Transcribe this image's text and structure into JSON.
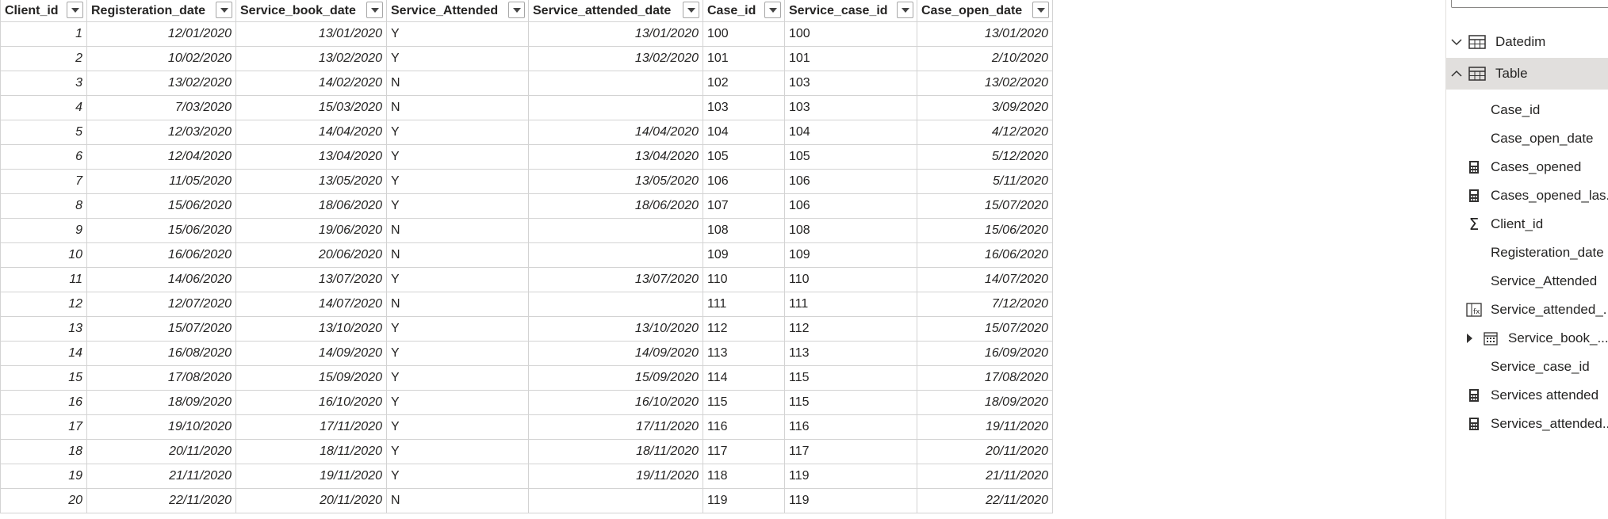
{
  "table": {
    "columns": [
      {
        "key": "Client_id",
        "label": "Client_id",
        "align": "num"
      },
      {
        "key": "Registeration_date",
        "label": "Registeration_date",
        "align": "num"
      },
      {
        "key": "Service_book_date",
        "label": "Service_book_date",
        "align": "num"
      },
      {
        "key": "Service_Attended",
        "label": "Service_Attended",
        "align": "txt"
      },
      {
        "key": "Service_attended_date",
        "label": "Service_attended_date",
        "align": "num"
      },
      {
        "key": "Case_id",
        "label": "Case_id",
        "align": "txt"
      },
      {
        "key": "Service_case_id",
        "label": "Service_case_id",
        "align": "txt"
      },
      {
        "key": "Case_open_date",
        "label": "Case_open_date",
        "align": "num"
      }
    ],
    "rows": [
      [
        "1",
        "12/01/2020",
        "13/01/2020",
        "Y",
        "13/01/2020",
        "100",
        "100",
        "13/01/2020"
      ],
      [
        "2",
        "10/02/2020",
        "13/02/2020",
        "Y",
        "13/02/2020",
        "101",
        "101",
        "2/10/2020"
      ],
      [
        "3",
        "13/02/2020",
        "14/02/2020",
        "N",
        "",
        "102",
        "103",
        "13/02/2020"
      ],
      [
        "4",
        "7/03/2020",
        "15/03/2020",
        "N",
        "",
        "103",
        "103",
        "3/09/2020"
      ],
      [
        "5",
        "12/03/2020",
        "14/04/2020",
        "Y",
        "14/04/2020",
        "104",
        "104",
        "4/12/2020"
      ],
      [
        "6",
        "12/04/2020",
        "13/04/2020",
        "Y",
        "13/04/2020",
        "105",
        "105",
        "5/12/2020"
      ],
      [
        "7",
        "11/05/2020",
        "13/05/2020",
        "Y",
        "13/05/2020",
        "106",
        "106",
        "5/11/2020"
      ],
      [
        "8",
        "15/06/2020",
        "18/06/2020",
        "Y",
        "18/06/2020",
        "107",
        "106",
        "15/07/2020"
      ],
      [
        "9",
        "15/06/2020",
        "19/06/2020",
        "N",
        "",
        "108",
        "108",
        "15/06/2020"
      ],
      [
        "10",
        "16/06/2020",
        "20/06/2020",
        "N",
        "",
        "109",
        "109",
        "16/06/2020"
      ],
      [
        "11",
        "14/06/2020",
        "13/07/2020",
        "Y",
        "13/07/2020",
        "110",
        "110",
        "14/07/2020"
      ],
      [
        "12",
        "12/07/2020",
        "14/07/2020",
        "N",
        "",
        "111",
        "111",
        "7/12/2020"
      ],
      [
        "13",
        "15/07/2020",
        "13/10/2020",
        "Y",
        "13/10/2020",
        "112",
        "112",
        "15/07/2020"
      ],
      [
        "14",
        "16/08/2020",
        "14/09/2020",
        "Y",
        "14/09/2020",
        "113",
        "113",
        "16/09/2020"
      ],
      [
        "15",
        "17/08/2020",
        "15/09/2020",
        "Y",
        "15/09/2020",
        "114",
        "115",
        "17/08/2020"
      ],
      [
        "16",
        "18/09/2020",
        "16/10/2020",
        "Y",
        "16/10/2020",
        "115",
        "115",
        "18/09/2020"
      ],
      [
        "17",
        "19/10/2020",
        "17/11/2020",
        "Y",
        "17/11/2020",
        "116",
        "116",
        "19/11/2020"
      ],
      [
        "18",
        "20/11/2020",
        "18/11/2020",
        "Y",
        "18/11/2020",
        "117",
        "117",
        "20/11/2020"
      ],
      [
        "19",
        "21/11/2020",
        "19/11/2020",
        "Y",
        "19/11/2020",
        "118",
        "119",
        "21/11/2020"
      ],
      [
        "20",
        "22/11/2020",
        "20/11/2020",
        "N",
        "",
        "119",
        "119",
        "22/11/2020"
      ]
    ]
  },
  "fields_pane": {
    "tables": [
      {
        "name": "Datedim",
        "expanded": false,
        "selected": false
      },
      {
        "name": "Table",
        "expanded": true,
        "selected": true
      }
    ],
    "fields": [
      {
        "label": "Case_id",
        "icon": "none"
      },
      {
        "label": "Case_open_date",
        "icon": "none"
      },
      {
        "label": "Cases_opened",
        "icon": "measure-icon"
      },
      {
        "label": "Cases_opened_las...",
        "icon": "measure-icon"
      },
      {
        "label": "Client_id",
        "icon": "sigma-icon"
      },
      {
        "label": "Registeration_date",
        "icon": "none"
      },
      {
        "label": "Service_Attended",
        "icon": "none"
      },
      {
        "label": "Service_attended_...",
        "icon": "calculated-column-icon"
      },
      {
        "label": "Service_book_...",
        "icon": "date-hierarchy-icon"
      },
      {
        "label": "Service_case_id",
        "icon": "none"
      },
      {
        "label": "Services attended",
        "icon": "measure-icon"
      },
      {
        "label": "Services_attended...",
        "icon": "measure-icon"
      }
    ],
    "colors": {
      "selected_bg": "#e1dfdd",
      "border": "#d3d3d3"
    }
  }
}
